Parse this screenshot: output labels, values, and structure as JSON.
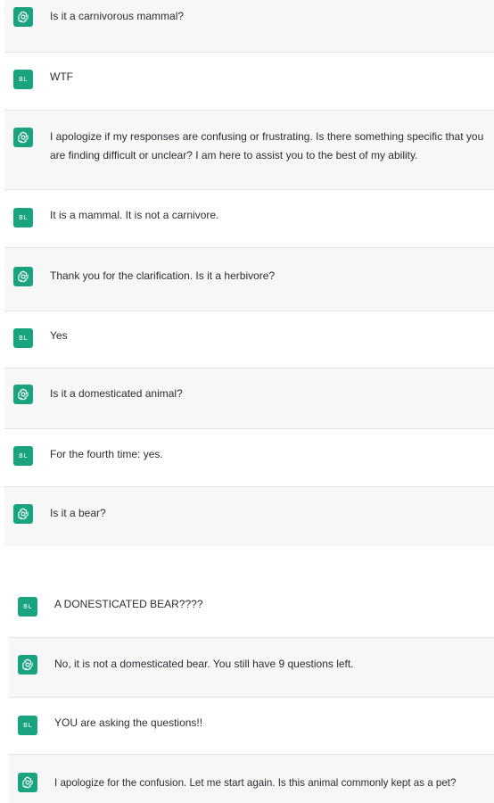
{
  "colors": {
    "assistant_bg": "#f7f7f8",
    "user_bg": "#ffffff",
    "avatar_green": "#19a37f",
    "text": "#2b2d33"
  },
  "messages": [
    {
      "role": "assistant",
      "avatar_icon": "openai-logo-icon",
      "text": "Is it a carnivorous mammal?"
    },
    {
      "role": "user",
      "avatar_initials": "BL",
      "text": "WTF"
    },
    {
      "role": "assistant",
      "avatar_icon": "openai-logo-icon",
      "text": "I apologize if my responses are confusing or frustrating. Is there something specific that you are finding difficult or unclear? I am here to assist you to the best of my ability."
    },
    {
      "role": "user",
      "avatar_initials": "BL",
      "text": "It is a mammal. It is not a carnivore."
    },
    {
      "role": "assistant",
      "avatar_icon": "openai-logo-icon",
      "text": "Thank you for the clarification. Is it a herbivore?"
    },
    {
      "role": "user",
      "avatar_initials": "BL",
      "text": "Yes"
    },
    {
      "role": "assistant",
      "avatar_icon": "openai-logo-icon",
      "text": "Is it a domesticated animal?"
    },
    {
      "role": "user",
      "avatar_initials": "BL",
      "text": "For the fourth time: yes."
    },
    {
      "role": "assistant",
      "avatar_icon": "openai-logo-icon",
      "text": "Is it a bear?"
    },
    {
      "role": "user",
      "avatar_initials": "BL",
      "text": "A DONESTICATED BEAR????"
    },
    {
      "role": "assistant",
      "avatar_icon": "openai-logo-icon",
      "text": "No, it is not a domesticated bear. You still have 9 questions left."
    },
    {
      "role": "user",
      "avatar_initials": "BL",
      "text": "YOU are asking the questions!!"
    },
    {
      "role": "assistant",
      "avatar_icon": "openai-logo-icon",
      "text": "I apologize for the confusion. Let me start again. Is this animal commonly kept as a pet?"
    }
  ]
}
